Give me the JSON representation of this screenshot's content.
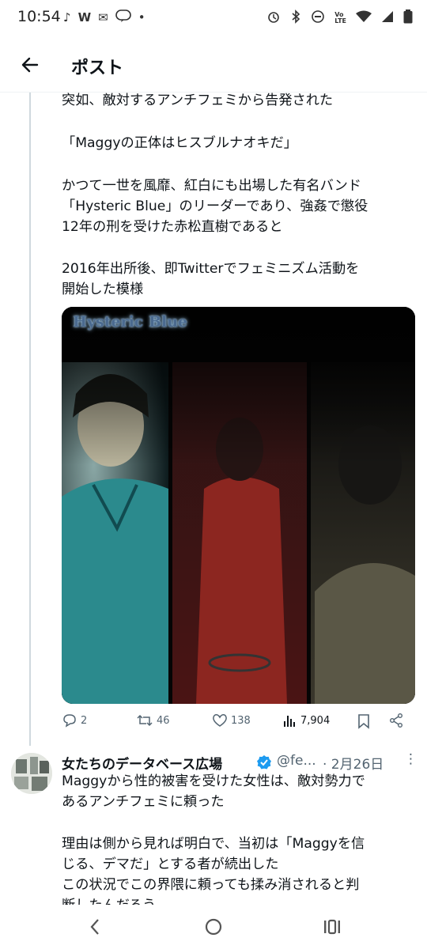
{
  "status": {
    "time": "10:54",
    "left_icons": [
      "tiktok-icon",
      "w-icon",
      "mail-icon",
      "line-icon",
      "dot-icon"
    ],
    "right_icons": [
      "alarm-icon",
      "bluetooth-icon",
      "dnd-icon",
      "volte-icon",
      "wifi-icon",
      "signal-icon",
      "battery-icon"
    ]
  },
  "header": {
    "title": "ポスト"
  },
  "tweet1": {
    "lines": [
      "突如、敵対するアンチフェミから告発された",
      "「Maggyの正体はヒスブルナオキだ」",
      "かつて一世を風靡、紅白にも出場した有名バンド",
      "「Hysteric Blue」のリーダーであり、強姦で懲役",
      "12年の刑を受けた赤松直樹であると",
      "2016年出所後、即Twitterでフェミニズム活動を",
      "開始した模様"
    ],
    "media_caption": "Hysteric Blue",
    "actions": {
      "replies": "2",
      "retweets": "46",
      "likes": "138",
      "views": "7,904"
    }
  },
  "tweet2": {
    "name": "女たちのデータベース広場",
    "handle": "@fe...",
    "date": "· 2月26日",
    "lines": [
      "Maggyから性的被害を受けた女性は、敵対勢力で",
      "あるアンチフェミに頼った",
      "理由は側から見れば明白で、当初は「Maggyを信",
      "じる、デマだ」とする者が続出した",
      "この状況でこの界隈に頼っても揉み消されると判",
      "断したんだろう"
    ]
  },
  "colors": {
    "text": "#0f1419",
    "muted": "#536471",
    "accent": "#1d9bf0"
  }
}
